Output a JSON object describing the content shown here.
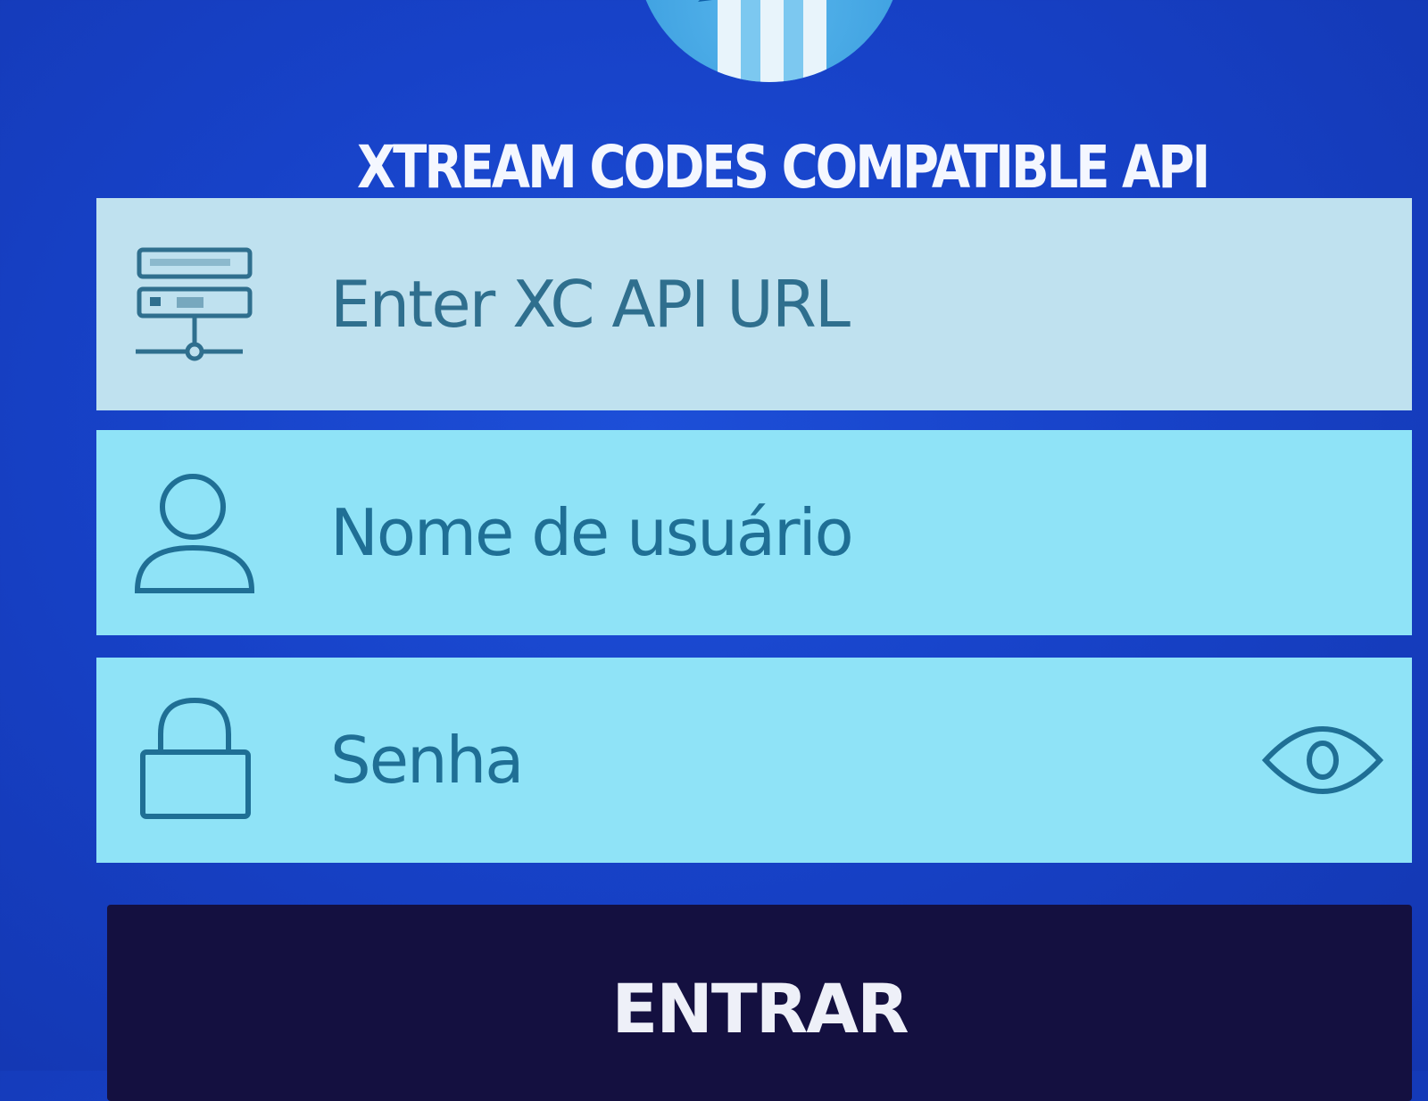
{
  "app": {
    "title": "XTREAM CODES COMPATIBLE API"
  },
  "logo": {
    "icon": "app-logo-icon",
    "colors": {
      "circle": "#3d9fe0",
      "accent": "#e8f4fb"
    }
  },
  "form": {
    "url_field": {
      "icon": "server-icon",
      "placeholder": "Enter XC API URL"
    },
    "username_field": {
      "icon": "user-icon",
      "placeholder": "Nome de usuário"
    },
    "password_field": {
      "icon": "lock-icon",
      "placeholder": "Senha",
      "toggle_icon": "eye-icon"
    },
    "submit": {
      "label": "ENTRAR"
    }
  },
  "colors": {
    "background": "#1742c8",
    "field_inactive": "#bfe1ef",
    "field_active": "#8fe3f7",
    "field_text": "#1f6f95",
    "button": "#141040",
    "button_text": "#eef0f8"
  }
}
